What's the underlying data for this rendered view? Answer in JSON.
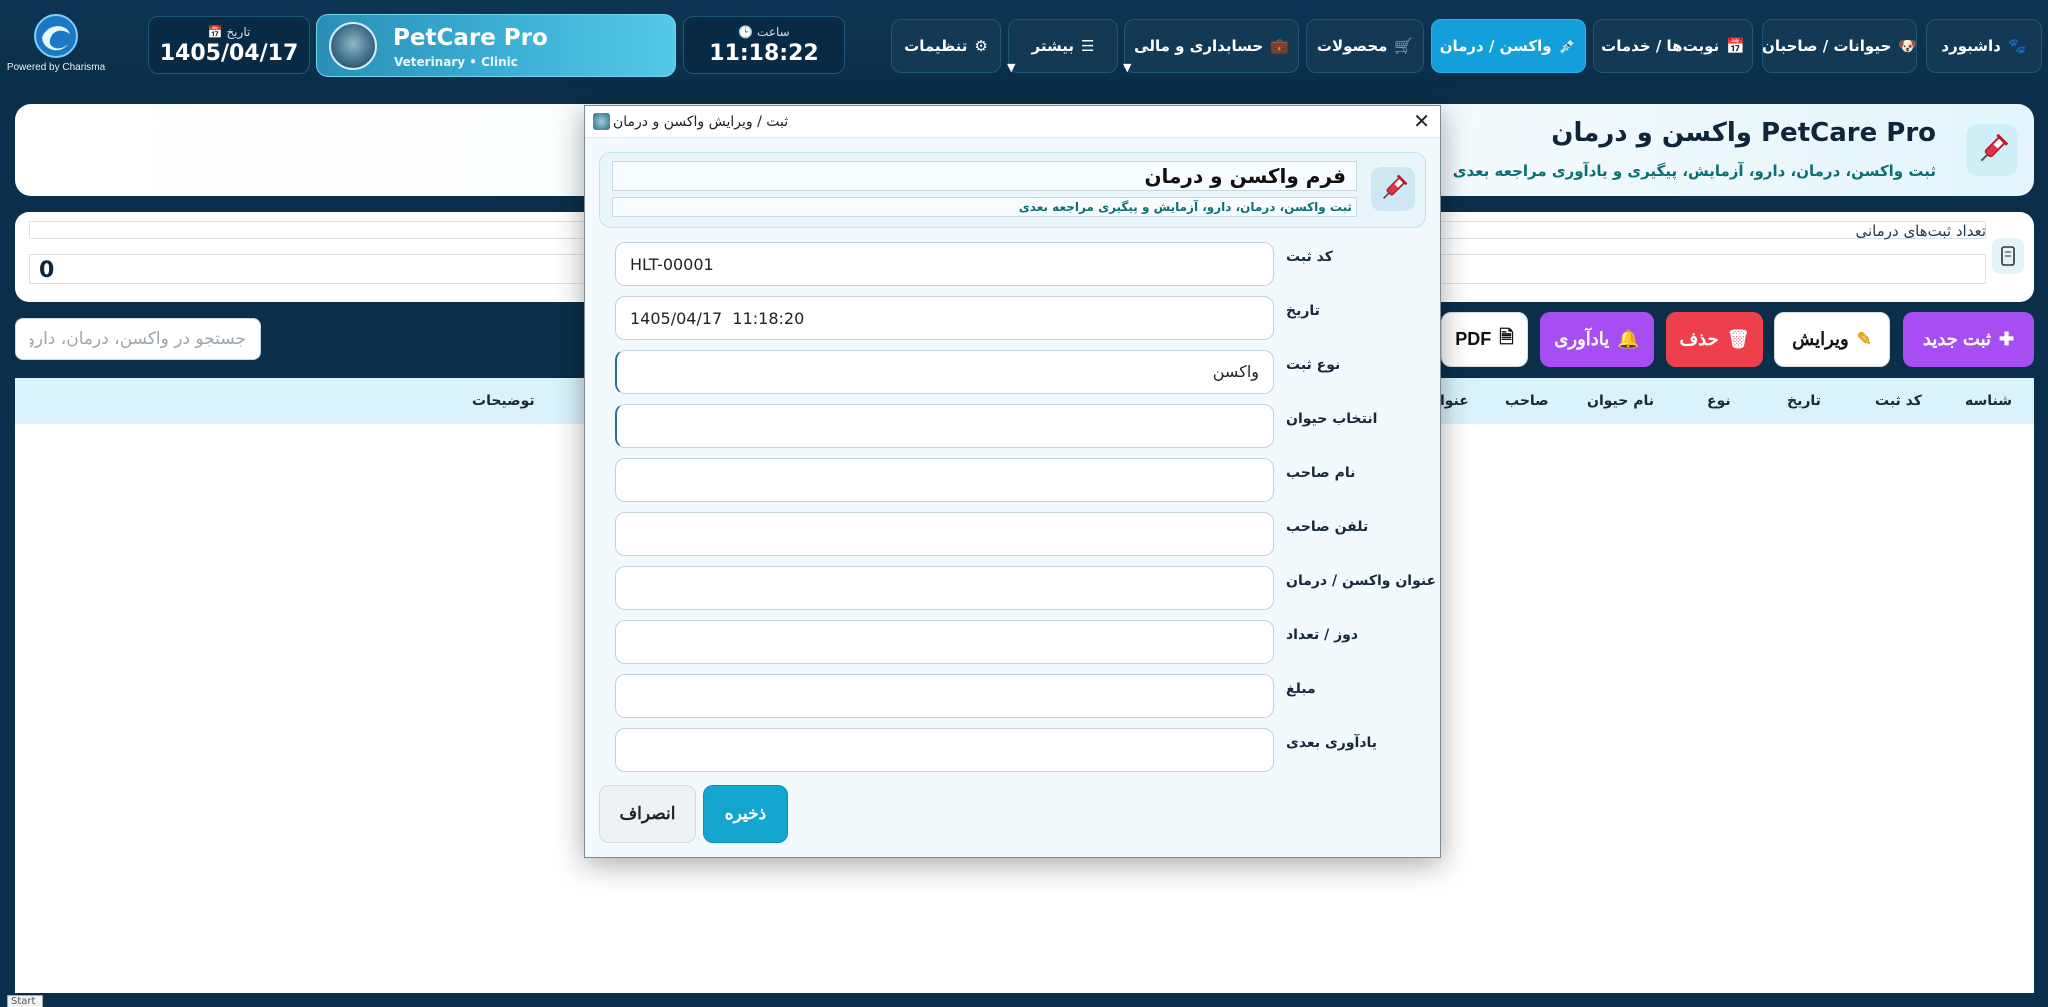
{
  "logo": {
    "powered_by": "Powered by Charisma"
  },
  "date": {
    "caption": "📅 تاریخ",
    "value": "1405/04/17"
  },
  "brand": {
    "title": "PetCare Pro",
    "subtitle": "Veterinary • Clinic"
  },
  "clock": {
    "caption": "🕒 ساعت",
    "value": "11:18:22"
  },
  "nav": [
    {
      "label": "داشبورد",
      "icon": "🐾"
    },
    {
      "label": "حیوانات / صاحبان",
      "icon": "🐶"
    },
    {
      "label": "نوبت‌ها / خدمات",
      "icon": "📅"
    },
    {
      "label": "واکسن / درمان",
      "icon": "💉",
      "active": true
    },
    {
      "label": "محصولات",
      "icon": "🛒"
    },
    {
      "label": "حسابداری و مالی",
      "icon": "💼"
    },
    {
      "label": "بیشتر",
      "icon": "☰"
    },
    {
      "label": "تنظیمات",
      "icon": "⚙"
    }
  ],
  "page": {
    "title": "واکسن و درمان PetCare Pro",
    "subtitle": "ثبت واکسن، درمان، دارو، آزمایش، پیگیری و یادآوری مراجعه بعدی"
  },
  "stats": {
    "label": "تعداد ثبت‌های درمانی",
    "value": "0"
  },
  "search": {
    "placeholder": "جستجو در واکسن، درمان، دارو..."
  },
  "actions": {
    "new_label": "ثبت جدید",
    "edit_label": "ویرایش",
    "delete_label": "حذف",
    "remind_label": "یادآوری",
    "pdf_label": "PDF"
  },
  "table": {
    "columns": [
      "شناسه",
      "کد ثبت",
      "تاریخ",
      "نوع",
      "نام حیوان",
      "صاحب",
      "عنوا",
      "توضیحات"
    ]
  },
  "modal": {
    "title": "ثبت / ویرایش واکسن و درمان",
    "form_title": "فرم واکسن و درمان",
    "form_subtitle": "ثبت واکسن، درمان، دارو، آزمایش و پیگیری مراجعه بعدی",
    "fields": [
      {
        "label": "کد ثبت",
        "value": "HLT-00001"
      },
      {
        "label": "تاریخ",
        "value": "1405/04/17  11:18:20"
      },
      {
        "label": "نوع ثبت",
        "value": "واکسن"
      },
      {
        "label": "انتخاب حیوان",
        "value": ""
      },
      {
        "label": "نام صاحب",
        "value": ""
      },
      {
        "label": "تلفن صاحب",
        "value": ""
      },
      {
        "label": "عنوان واکسن / درمان",
        "value": ""
      },
      {
        "label": "دوز / تعداد",
        "value": ""
      },
      {
        "label": "مبلغ",
        "value": ""
      },
      {
        "label": "یادآوری بعدی",
        "value": ""
      }
    ],
    "save_label": "ذخیره",
    "cancel_label": "انصراف"
  },
  "taskbar": {
    "start_label": "Start"
  },
  "colors": {
    "nav_bg": "#0d3553",
    "active_tab": "#139fdc",
    "purple": "#a64ef2",
    "danger": "#ee3f4c",
    "save": "#15a6cf",
    "table_head": "#daf3fb"
  }
}
